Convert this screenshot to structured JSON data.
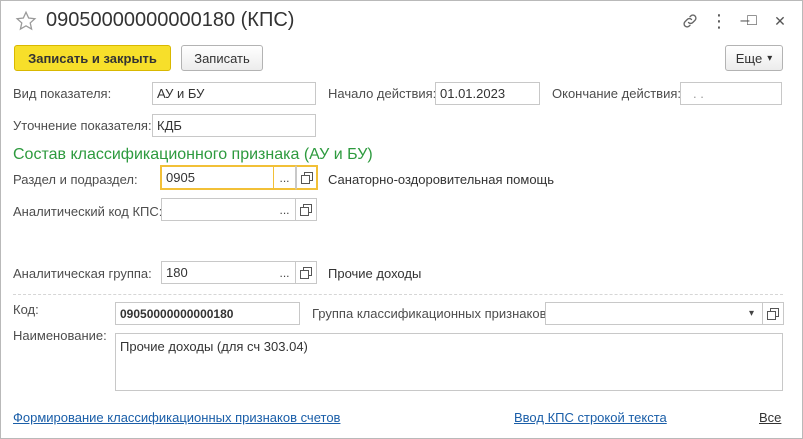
{
  "window": {
    "title": "09050000000000180 (КПС)"
  },
  "toolbar": {
    "save_close_label": "Записать и закрыть",
    "save_label": "Записать",
    "more_label": "Еще"
  },
  "fields": {
    "indicator_type_label": "Вид показателя:",
    "indicator_type_value": "АУ и БУ",
    "start_date_label": "Начало действия:",
    "start_date_value": "01.01.2023",
    "end_date_label": "Окончание действия:",
    "end_date_value": ". .",
    "refinement_label": "Уточнение показателя:",
    "refinement_value": "КДБ"
  },
  "section": {
    "title": "Состав классификационного признака (АУ и БУ)",
    "section_label": "Раздел и подраздел:",
    "section_value": "0905",
    "section_desc": "Санаторно-оздоровительная помощь",
    "analytic_code_label": "Аналитический код КПС:",
    "analytic_code_value": "",
    "analytic_group_label": "Аналитическая группа:",
    "analytic_group_value": "180",
    "analytic_group_desc": "Прочие доходы"
  },
  "bottom": {
    "code_label": "Код:",
    "code_value": "09050000000000180",
    "group_label": "Группа классификационных признаков:",
    "group_value": "",
    "name_label": "Наименование:",
    "name_value": "Прочие доходы (для сч 303.04)"
  },
  "footer": {
    "link_left": "Формирование классификационных признаков счетов",
    "link_mid": "Ввод КПС строкой текста",
    "link_right": "Все"
  },
  "glyphs": {
    "ellipsis": "...",
    "more_arrow": "▾",
    "dropdown_arrow": "▾",
    "kebab": "⋮",
    "minimize": "–",
    "maximize": "□",
    "close": "✕"
  },
  "colors": {
    "primary_button": "#f7df2a",
    "section_title": "#2d9a3e",
    "link": "#1a5ea8",
    "focus_border": "#f2c037"
  }
}
